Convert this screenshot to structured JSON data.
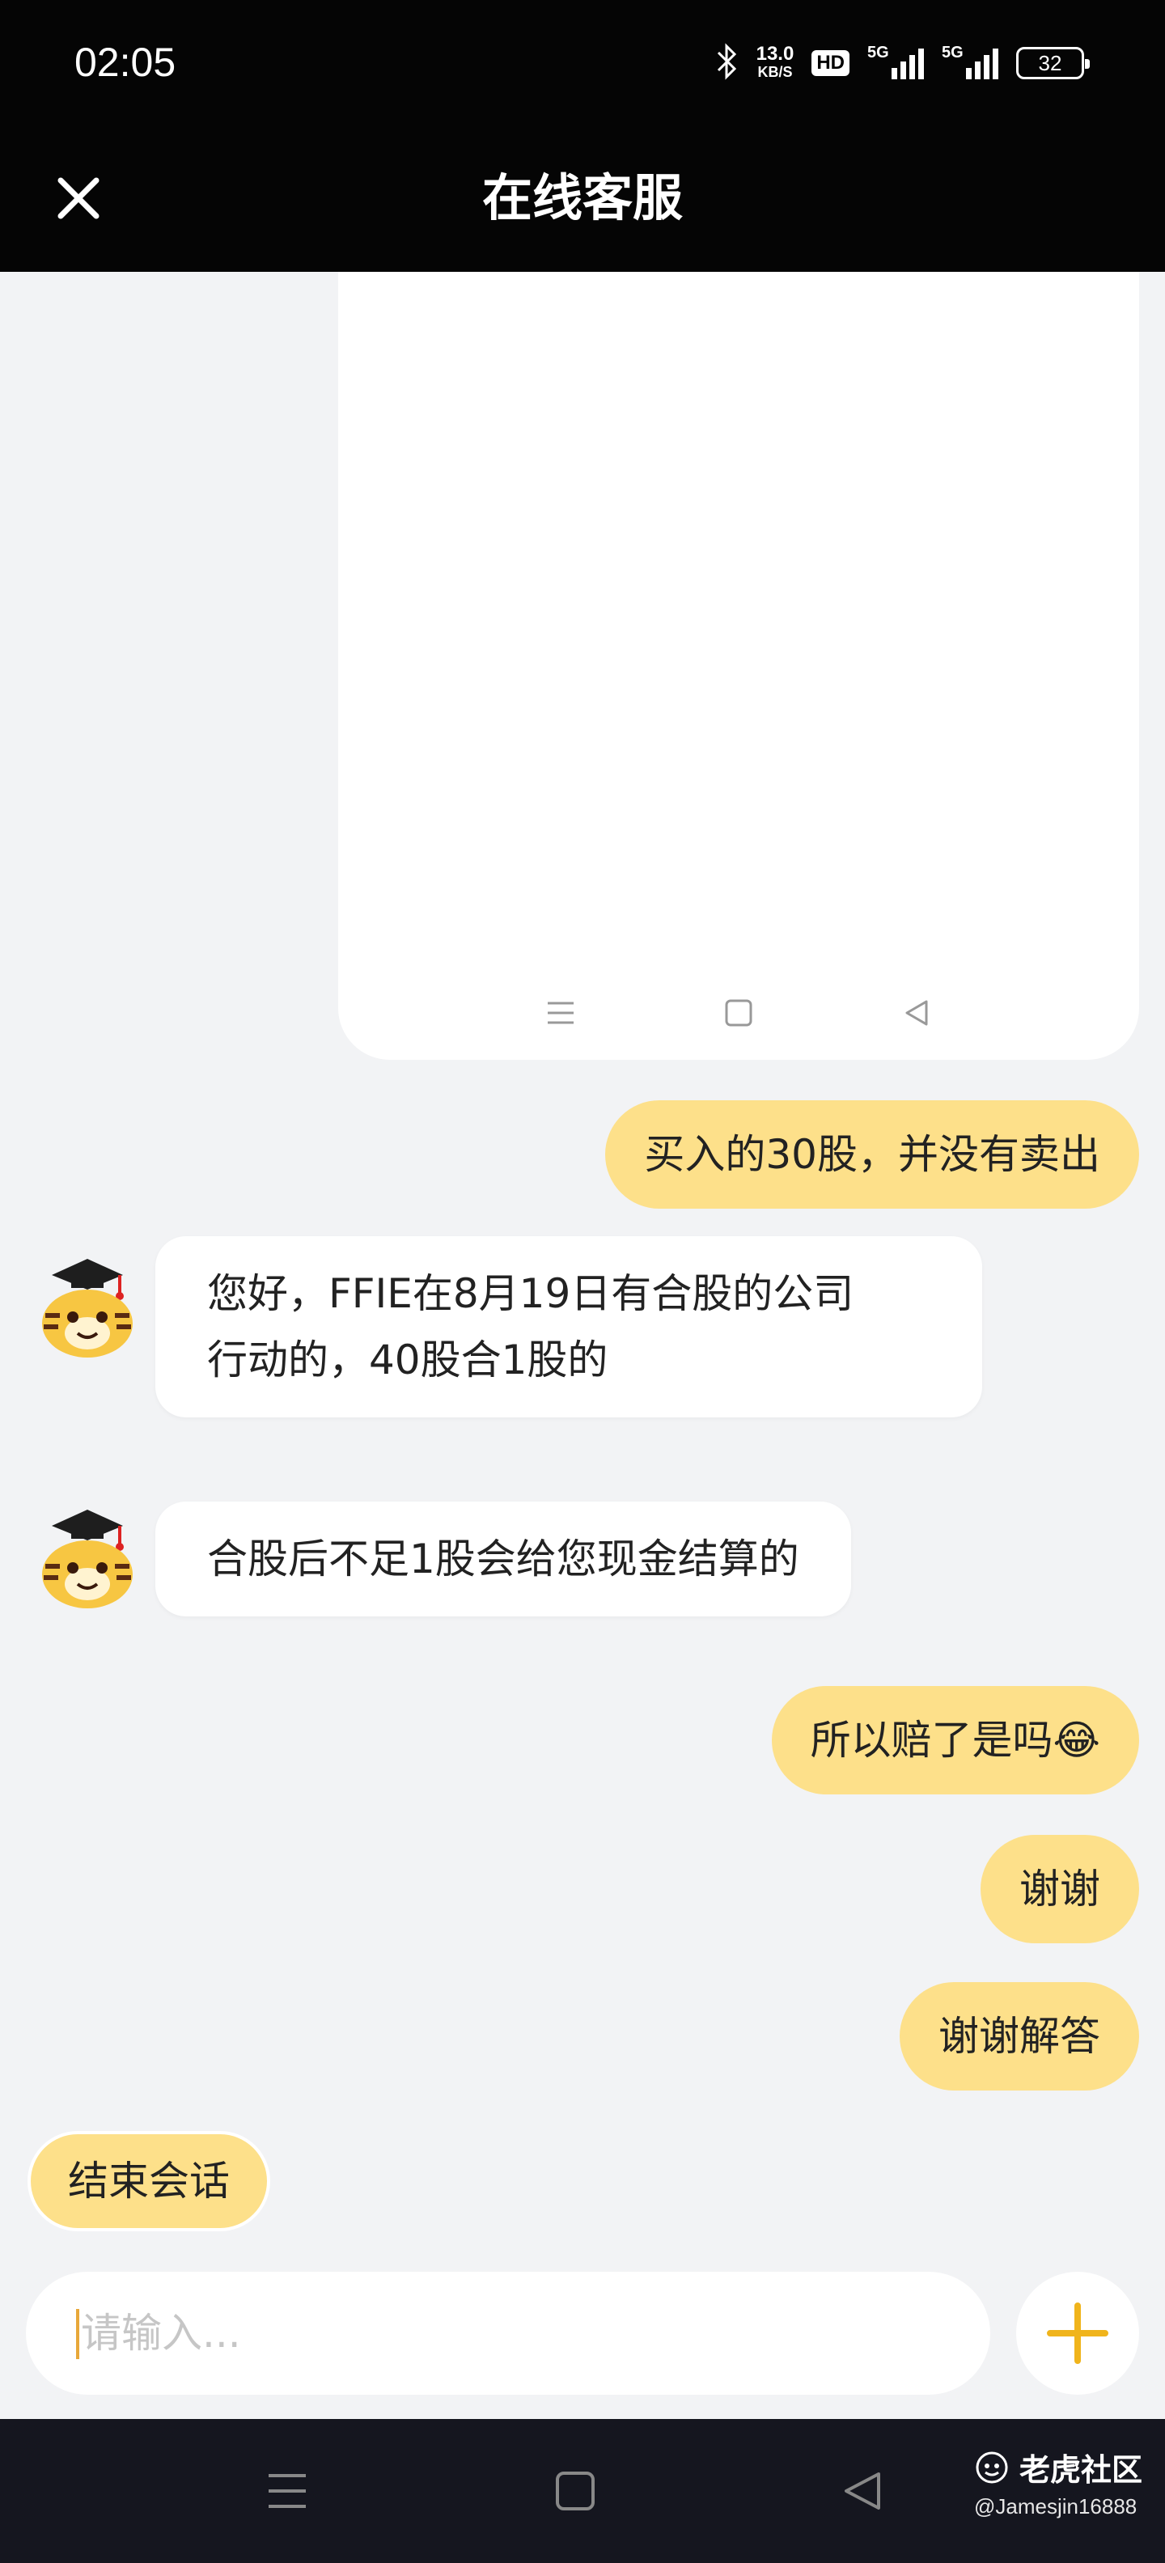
{
  "status_bar": {
    "time": "02:05",
    "net_speed_value": "13.0",
    "net_speed_unit": "KB/S",
    "hd_label": "HD",
    "signal_1_label": "5G",
    "signal_2_label": "5G",
    "battery": "32"
  },
  "header": {
    "title": "在线客服",
    "close_icon": "close-icon"
  },
  "messages": [
    {
      "from": "user",
      "text": "买入的30股，并没有卖出"
    },
    {
      "from": "agent",
      "lines": [
        "您好，FFIE在8月19日有合股的公司",
        "行动的，40股合1股的"
      ]
    },
    {
      "from": "agent",
      "text": "合股后不足1股会给您现金结算的"
    },
    {
      "from": "user",
      "text": "所以赔了是吗😂"
    },
    {
      "from": "user",
      "text": "谢谢"
    },
    {
      "from": "user",
      "text": "谢谢解答"
    }
  ],
  "end_session_label": "结束会话",
  "input": {
    "placeholder": "请输入...",
    "value": ""
  },
  "watermark": {
    "brand": "老虎社区",
    "user": "@Jamesjin16888"
  },
  "colors": {
    "header_bg": "#050505",
    "user_bubble": "#fde08a",
    "accent": "#f0b41c",
    "page_bg": "#f2f3f5"
  }
}
